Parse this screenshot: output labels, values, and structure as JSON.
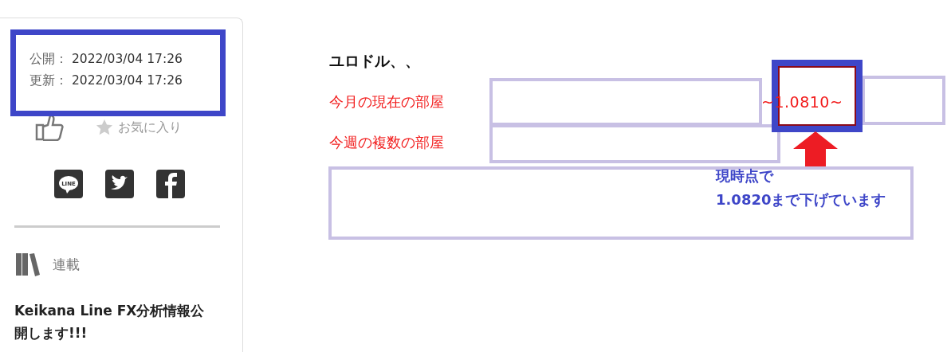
{
  "sidebar": {
    "dates": [
      {
        "label": "公開：",
        "value": "2022/03/04 17:26"
      },
      {
        "label": "更新：",
        "value": "2022/03/04 17:26"
      }
    ],
    "favorite": "お気に入り",
    "line_logo": "LINE",
    "series_label": "連載",
    "series_title": "Keikana Line FX分析情報公開します!!!"
  },
  "article": {
    "heading": "ユロドル、、",
    "rows": [
      {
        "label": "今月の現在の部屋"
      },
      {
        "label": "今週の複数の部屋"
      }
    ],
    "price": "~1.0810~",
    "note": [
      "現時点で",
      "1.0820まで下げています"
    ]
  }
}
